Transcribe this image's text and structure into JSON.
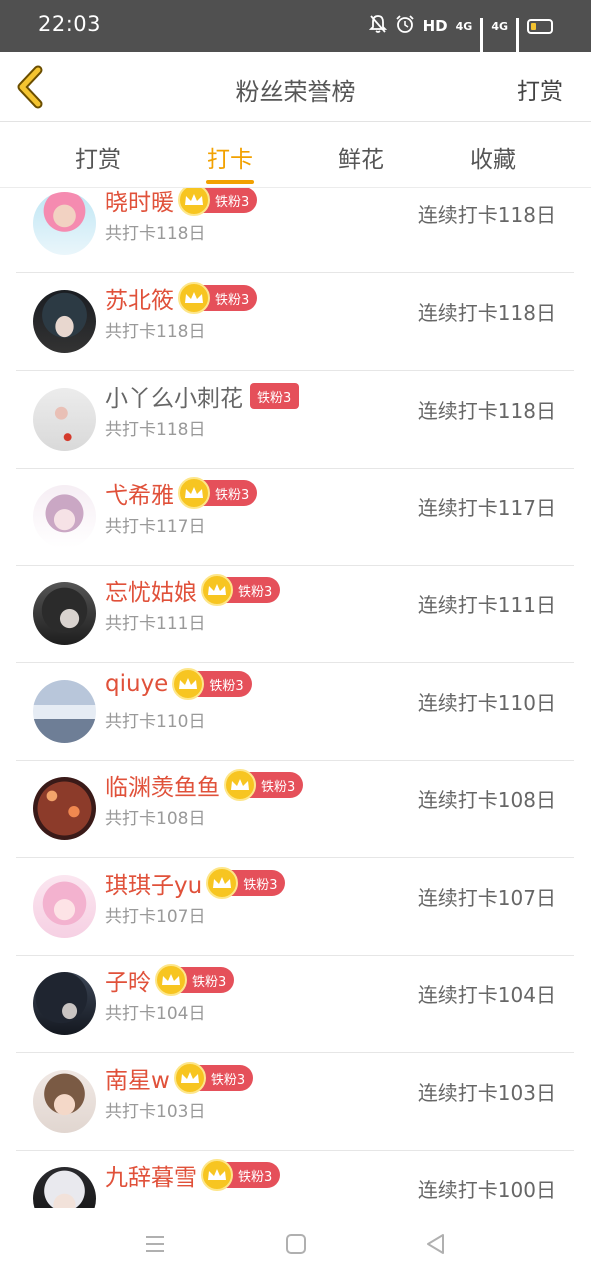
{
  "status_bar": {
    "time": "22:03",
    "hd_label": "HD",
    "net1": "4G",
    "net2": "4G"
  },
  "header": {
    "title": "粉丝荣誉榜",
    "reward_link": "打赏"
  },
  "tabs": [
    {
      "label": "打赏",
      "active": false
    },
    {
      "label": "打卡",
      "active": true
    },
    {
      "label": "鲜花",
      "active": false
    },
    {
      "label": "收藏",
      "active": false
    }
  ],
  "colors": {
    "accent": "#f2a100",
    "name_red": "#e0513a",
    "badge": "#e5505a",
    "crown": "#f7c521",
    "status_bar": "#505050"
  },
  "rows": [
    {
      "name": "晓时暖",
      "badge": "铁粉3",
      "crown": true,
      "total": "共打卡118日",
      "streak": "连续打卡118日",
      "avatar_icon": "pink-hair-avatar"
    },
    {
      "name": "苏北筱",
      "badge": "铁粉3",
      "crown": true,
      "total": "共打卡118日",
      "streak": "连续打卡118日",
      "avatar_icon": "dark-hair-avatar"
    },
    {
      "name": "小丫么小刺花",
      "badge": "铁粉3",
      "crown": false,
      "total": "共打卡118日",
      "streak": "连续打卡118日",
      "avatar_icon": "hand-avatar"
    },
    {
      "name": "弋希雅",
      "badge": "铁粉3",
      "crown": true,
      "total": "共打卡117日",
      "streak": "连续打卡117日",
      "avatar_icon": "bunny-ears-avatar"
    },
    {
      "name": "忘忧姑娘",
      "badge": "铁粉3",
      "crown": true,
      "total": "共打卡111日",
      "streak": "连续打卡111日",
      "avatar_icon": "long-hair-avatar"
    },
    {
      "name": "qiuye",
      "badge": "铁粉3",
      "crown": true,
      "total": "共打卡110日",
      "streak": "连续打卡110日",
      "avatar_icon": "snow-mountain-avatar"
    },
    {
      "name": "临渊羡鱼鱼",
      "badge": "铁粉3",
      "crown": true,
      "total": "共打卡108日",
      "streak": "连续打卡108日",
      "avatar_icon": "bokeh-avatar"
    },
    {
      "name": "琪琪子yu",
      "badge": "铁粉3",
      "crown": true,
      "total": "共打卡107日",
      "streak": "连续打卡107日",
      "avatar_icon": "anime-girl-avatar"
    },
    {
      "name": "子昤",
      "badge": "铁粉3",
      "crown": true,
      "total": "共打卡104日",
      "streak": "连续打卡104日",
      "avatar_icon": "dark-figure-avatar"
    },
    {
      "name": "南星w",
      "badge": "铁粉3",
      "crown": true,
      "total": "共打卡103日",
      "streak": "连续打卡103日",
      "avatar_icon": "child-avatar"
    },
    {
      "name": "九辞暮雪",
      "badge": "铁粉3",
      "crown": true,
      "total": "",
      "streak": "连续打卡100日",
      "avatar_icon": "white-hair-avatar"
    }
  ]
}
